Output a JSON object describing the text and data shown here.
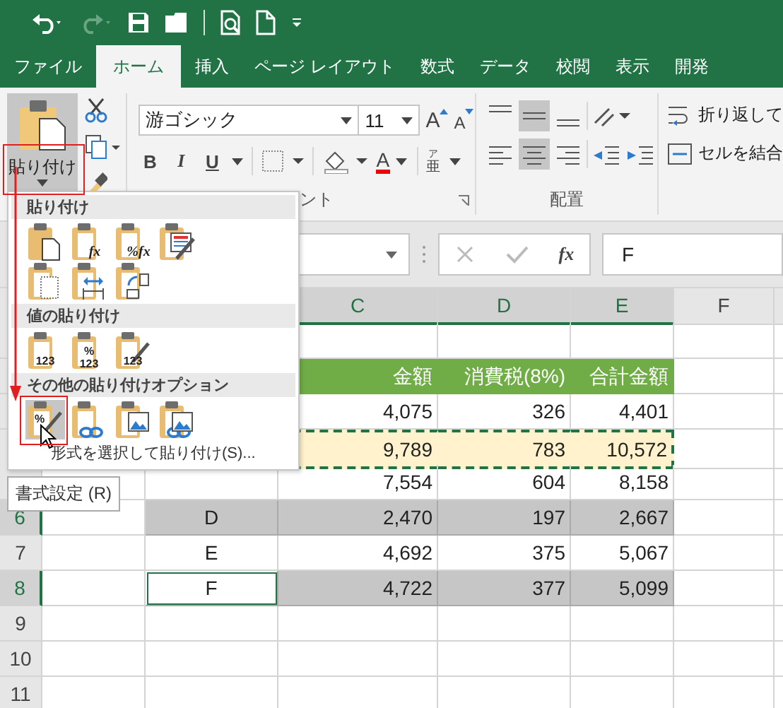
{
  "tabs": [
    {
      "label": "ファイル",
      "selected": false
    },
    {
      "label": "ホーム",
      "selected": true
    },
    {
      "label": "挿入",
      "selected": false
    },
    {
      "label": "ページ レイアウト",
      "selected": false
    },
    {
      "label": "数式",
      "selected": false
    },
    {
      "label": "データ",
      "selected": false
    },
    {
      "label": "校閲",
      "selected": false
    },
    {
      "label": "表示",
      "selected": false
    },
    {
      "label": "開発",
      "selected": false
    }
  ],
  "ribbon": {
    "paste_label": "貼り付け",
    "font_name": "游ゴシック",
    "font_size": "11",
    "size_buttons": [
      {
        "kind": "grow",
        "glyph": "A"
      },
      {
        "kind": "shrink",
        "glyph": "A"
      }
    ],
    "style_buttons": [
      {
        "kind": "bold",
        "glyph": "B"
      },
      {
        "kind": "italic",
        "glyph": "I"
      },
      {
        "kind": "underline",
        "glyph": "U"
      }
    ],
    "font_color_glyph": "A",
    "phonetic": {
      "top": "ア",
      "main": "亜"
    },
    "wrap_text": "折り返して",
    "merge_cells": "セルを結合",
    "font_group_label": "ント",
    "alignment_group_label": "配置"
  },
  "formula_bar": {
    "fx": "fx",
    "value": "F"
  },
  "columns": [
    {
      "label": "C",
      "selected": true
    },
    {
      "label": "D",
      "selected": true
    },
    {
      "label": "E",
      "selected": true
    },
    {
      "label": "F",
      "selected": false
    }
  ],
  "rows": [
    {
      "kind": "data",
      "selected": false,
      "copied": false
    },
    {
      "kind": "header",
      "selected": false,
      "copied": false,
      "amount": "金額",
      "tax": "消費税(8%)",
      "total": "合計金額"
    },
    {
      "kind": "data",
      "selected": false,
      "copied": false,
      "amount": "4,075",
      "tax": "326",
      "total": "4,401"
    },
    {
      "kind": "data",
      "selected": false,
      "copied": true,
      "amount": "9,789",
      "tax": "783",
      "total": "10,572"
    },
    {
      "kind": "data",
      "selected": false,
      "copied": false,
      "amount": "7,554",
      "tax": "604",
      "total": "8,158"
    },
    {
      "kind": "data",
      "number": "6",
      "selected": true,
      "active": false,
      "copied": false,
      "item": "D",
      "amount": "2,470",
      "tax": "197",
      "total": "2,667"
    },
    {
      "kind": "data",
      "number": "7",
      "selected": false,
      "active": false,
      "copied": false,
      "item": "E",
      "amount": "4,692",
      "tax": "375",
      "total": "5,067"
    },
    {
      "kind": "data",
      "number": "8",
      "selected": true,
      "active": true,
      "copied": false,
      "item": "F",
      "amount": "4,722",
      "tax": "377",
      "total": "5,099"
    },
    {
      "kind": "data",
      "number": "9",
      "selected": false,
      "active": false,
      "copied": false
    },
    {
      "kind": "data",
      "number": "10",
      "selected": false,
      "active": false,
      "copied": false
    },
    {
      "kind": "data",
      "number": "11",
      "selected": false,
      "active": false,
      "copied": false
    }
  ],
  "paste_menu": {
    "sections": [
      {
        "title": "貼り付け",
        "options": [
          {
            "kind": "all",
            "selected": false
          },
          {
            "kind": "formulas",
            "glyph": [
              "fx"
            ],
            "selected": false
          },
          {
            "kind": "formulas-number",
            "glyph": [
              "%fx"
            ],
            "selected": false
          },
          {
            "kind": "keep-source",
            "selected": false
          },
          {
            "kind": "no-borders",
            "selected": false
          },
          {
            "kind": "keep-widths",
            "selected": false
          },
          {
            "kind": "transpose",
            "selected": false
          }
        ]
      },
      {
        "title": "値の貼り付け",
        "options": [
          {
            "kind": "values",
            "glyph": [
              "123"
            ],
            "selected": false
          },
          {
            "kind": "values-number",
            "glyph": [
              "%",
              "123"
            ],
            "selected": false
          },
          {
            "kind": "values-source",
            "glyph": [
              "123"
            ],
            "selected": false
          }
        ]
      },
      {
        "title": "その他の貼り付けオプション",
        "options": [
          {
            "kind": "formatting",
            "glyph": [
              "%"
            ],
            "selected": true
          },
          {
            "kind": "link",
            "selected": false
          },
          {
            "kind": "picture",
            "selected": false
          },
          {
            "kind": "linked-picture",
            "selected": false
          }
        ]
      }
    ],
    "special": "形式を選択して貼り付け(S)...",
    "tooltip": "書式設定 (R)"
  }
}
